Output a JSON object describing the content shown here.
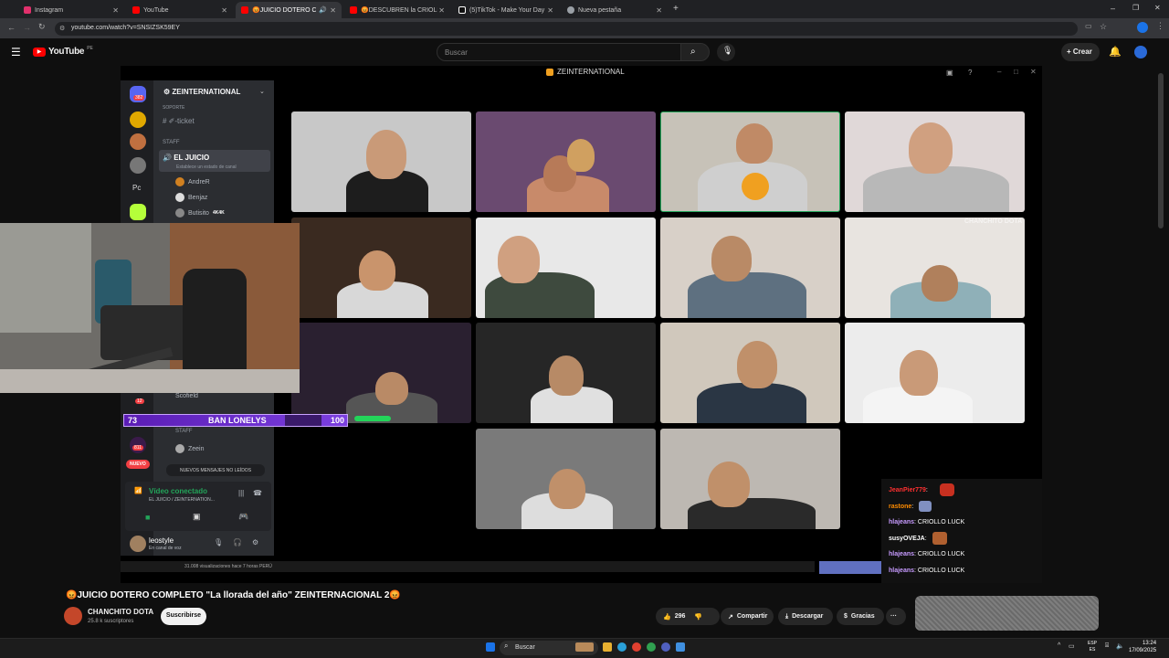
{
  "browser": {
    "tabs": [
      {
        "label": "Instagram",
        "color": "#e1306c"
      },
      {
        "label": "YouTube",
        "color": "#ff0000"
      },
      {
        "label": "😡JUICIO DOTERO COMPL",
        "color": "#ff0000"
      },
      {
        "label": "😡DESCUBREN la CRIOLLADA",
        "color": "#ff0000"
      },
      {
        "label": "(5)TikTok - Make Your Day",
        "color": "#ffffff"
      },
      {
        "label": "Nueva pestaña",
        "color": "#9aa0a6"
      }
    ],
    "url": "youtube.com/watch?v=SNSIZSK59EY"
  },
  "youtube": {
    "logo": "YouTube",
    "region": "PE",
    "search_placeholder": "Buscar",
    "create_label": "Crear"
  },
  "discord": {
    "window_title": "ZEINTERNATIONAL",
    "server_name": "ZEINTERNATIONAL",
    "sidebar_labels": {
      "badge_top": "382",
      "pc": "Pc",
      "badge_a": "12",
      "badge_b": "811",
      "nuevo": "NUEVO"
    },
    "category_soporte": "SOPORTE",
    "channel_ticket": "ticket",
    "category_staff": "STAFF",
    "voice_channel": "EL JUICIO",
    "status_hint": "Establece un estado de canal",
    "members": [
      "AndreR",
      "Benjaz",
      "Butisito"
    ],
    "live_badge": "4K4K",
    "member_scofield": "Scofield",
    "category_staff2": "STAFF",
    "member_zeein": "Zeein",
    "new_messages": "NUEVOS MENSAJES NO LEÍDOS",
    "voice_connected": "Vídeo conectado",
    "voice_sub": "EL JUICIO / ZEINTERNATION...",
    "user_name": "leostyle",
    "user_status": "En canal de voz"
  },
  "overlay": {
    "score_left": "73",
    "score_label": "BAN LONELYS",
    "score_right": "100",
    "watermark": "CHANCHITO DOTA"
  },
  "chat": [
    {
      "user": "JeanPier779",
      "text": "",
      "color": "#ff3030"
    },
    {
      "user": "rastone",
      "text": "",
      "color": "#ff8c00"
    },
    {
      "user": "hlajeans",
      "text": "CRIOLLO LUCK",
      "color": "#c79bff"
    },
    {
      "user": "susyOVEJA",
      "text": "",
      "color": "#ffffff"
    },
    {
      "user": "hlajeans",
      "text": "CRIOLLO LUCK",
      "color": "#c79bff"
    },
    {
      "user": "hlajeans",
      "text": "CRIOLLO LUCK",
      "color": "#c79bff"
    }
  ],
  "player": {
    "views": "31.008 visualizaciones  hace 7 horas  PERÚ"
  },
  "video": {
    "title": "😡JUICIO DOTERO COMPLETO \"La llorada del año\" ZEINTERNACIONAL 2😡",
    "channel": "CHANCHITO DOTA",
    "subscribers": "25.8 k suscriptores",
    "subscribe_label": "Suscribirse",
    "likes": "296",
    "share_label": "Compartir",
    "download_label": "Descargar",
    "thanks_label": "Gracias",
    "more_label": "···"
  },
  "taskbar": {
    "search_label": "Buscar",
    "lang_top": "ESP",
    "lang_bottom": "ES",
    "time": "13:24",
    "date": "17/09/2025"
  },
  "colors": {
    "youtube_red": "#ff0000",
    "discord_green": "#23a55a",
    "score_purple": "#7b3fe0"
  }
}
